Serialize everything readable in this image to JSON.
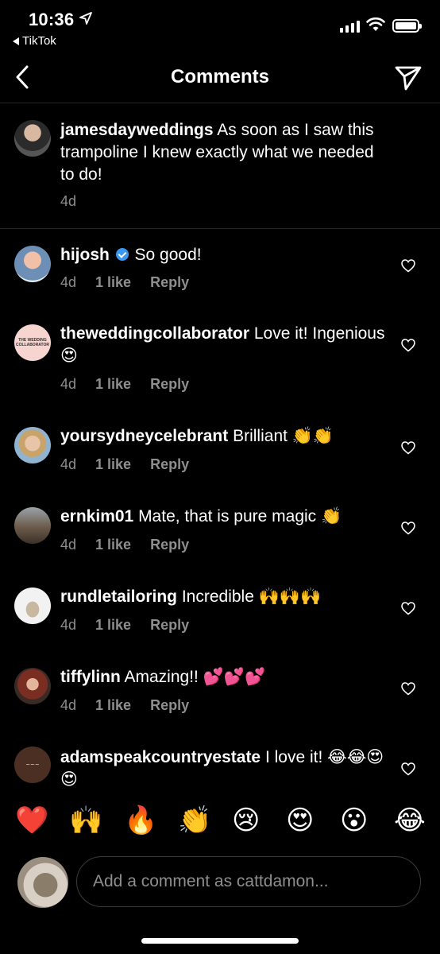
{
  "status": {
    "time": "10:36",
    "back_app": "TikTok"
  },
  "header": {
    "title": "Comments"
  },
  "caption": {
    "username": "jamesdayweddings",
    "text": " As soon as I saw this trampoline I knew exactly what we needed to do!",
    "time": "4d"
  },
  "comments": [
    {
      "username": "hijosh",
      "text": " So good!",
      "time": "4d",
      "likes": "1 like",
      "reply": "Reply"
    },
    {
      "username": "theweddingcollaborator",
      "text": " Love it! Ingenious 😍",
      "time": "4d",
      "likes": "1 like",
      "reply": "Reply"
    },
    {
      "username": "yoursydneycelebrant",
      "text": " Brilliant 👏👏",
      "time": "4d",
      "likes": "1 like",
      "reply": "Reply"
    },
    {
      "username": "ernkim01",
      "text": " Mate, that is pure magic 👏",
      "time": "4d",
      "likes": "1 like",
      "reply": "Reply"
    },
    {
      "username": "rundletailoring",
      "text": " Incredible 🙌🙌🙌",
      "time": "4d",
      "likes": "1 like",
      "reply": "Reply"
    },
    {
      "username": "tiffylinn",
      "text": " Amazing!! 💕💕💕",
      "time": "4d",
      "likes": "1 like",
      "reply": "Reply"
    },
    {
      "username": "adamspeakcountryestate",
      "text": " I love it! 😂😂😍😍"
    }
  ],
  "avatar_logo_text": {
    "line1": "THE WEDDING",
    "line2": "COLLABORATOR"
  },
  "emoji_bar": [
    "❤️",
    "🙌",
    "🔥",
    "👏",
    "😢",
    "😍",
    "😮",
    "😂"
  ],
  "input": {
    "placeholder": "Add a comment as cattdamon..."
  }
}
